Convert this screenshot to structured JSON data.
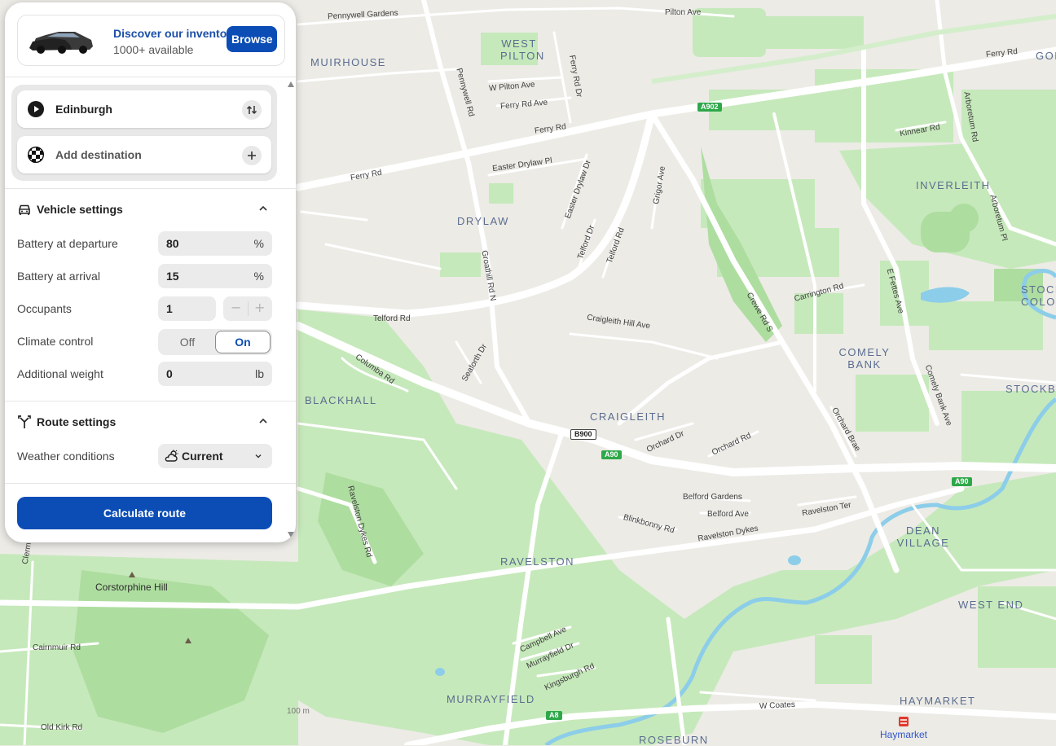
{
  "ad": {
    "title": "Discover our inventory",
    "subtitle": "1000+ available",
    "button": "Browse"
  },
  "waypoints": {
    "origin": "Edinburgh",
    "destination_placeholder": "Add destination"
  },
  "vehicle": {
    "title": "Vehicle settings",
    "battery_departure": {
      "label": "Battery at departure",
      "value": "80",
      "unit": "%"
    },
    "battery_arrival": {
      "label": "Battery at arrival",
      "value": "15",
      "unit": "%"
    },
    "occupants": {
      "label": "Occupants",
      "value": "1",
      "minus": "−",
      "plus": "+"
    },
    "climate": {
      "label": "Climate control",
      "off": "Off",
      "on": "On",
      "selected": "On"
    },
    "weight": {
      "label": "Additional weight",
      "value": "0",
      "unit": "lb"
    }
  },
  "route": {
    "title": "Route settings",
    "weather": {
      "label": "Weather conditions",
      "value": "Current"
    }
  },
  "calculate_button": "Calculate route",
  "colors": {
    "accent": "#0b4db5",
    "park": "#b9e5ad",
    "road": "#ffffff",
    "water": "#7ec8e8",
    "land": "#ecebe6"
  },
  "map": {
    "districts": [
      "MUIRHOUSE",
      "WEST PILTON",
      "DRYLAW",
      "INVERLEITH",
      "STOCK COLO",
      "COMELY BANK",
      "STOCKB",
      "BLACKHALL",
      "CRAIGLEITH",
      "DEAN VILLAGE",
      "RAVELSTON",
      "WEST END",
      "MURRAYFIELD",
      "HAYMARKET",
      "ROSEBURN",
      "GOL"
    ],
    "streets": [
      "Pennywell Gardens",
      "Pilton Ave",
      "Ferry Rd",
      "Pennywell Rd",
      "W Pilton Ave",
      "Ferry Rd Dr",
      "Ferry Rd Ave",
      "Ferry Rd",
      "Easter Drylaw Pl",
      "Ferry Rd",
      "Kinnear Rd",
      "Arboretum Rd",
      "Arboretum Pl",
      "Easter Drylaw Dr",
      "Grigor Ave",
      "Groathill Rd N",
      "Telford Dr",
      "Telford Rd",
      "Telford Rd",
      "Craigleith Hill Ave",
      "Carrington Rd",
      "Crewe Rd S",
      "E Fettes Ave",
      "Comely Bank Ave",
      "Columba Rd",
      "Seaforth Dr",
      "Orchard Brae",
      "Orchard Dr",
      "Orchard Rd",
      "Belford Gardens",
      "Belford Ave",
      "Blinkbonny Rd",
      "Ravelston Dykes",
      "Ravelston Ter",
      "Ravelston Dykes Rd",
      "Campbell Ave",
      "Murrayfield Dr",
      "Kingsburgh Rd",
      "Cairnmuir Rd",
      "Old Kirk Rd",
      "W Coates",
      "Clerm"
    ],
    "pois": [
      "Corstorphine Hill",
      "Haymarket"
    ],
    "shields": [
      "A902",
      "B900",
      "A90",
      "A90",
      "A8"
    ],
    "elevation": "100 m"
  }
}
